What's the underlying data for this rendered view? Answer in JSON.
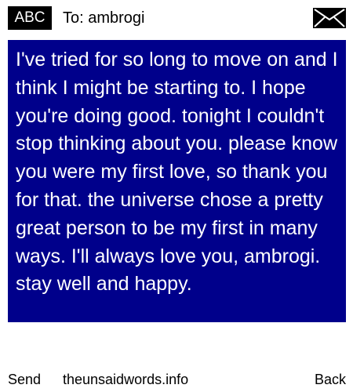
{
  "header": {
    "input_mode": "ABC",
    "recipient": "To: ambrogi",
    "icon": "envelope-icon"
  },
  "message": {
    "body": "I've tried for so long to move on and I think I might be starting to. I hope you're doing good. tonight I couldn't stop thinking about you. please know you were my first love, so thank you for that. the universe chose a pretty great person to be my first in many ways. I'll always love you, ambrogi. stay well and happy."
  },
  "softkeys": {
    "left_label": "Send",
    "center_text": "theunsaidwords.info",
    "right_label": "Back"
  },
  "colors": {
    "message_background": "#00008b",
    "message_text": "#ffffff",
    "badge_background": "#000000"
  }
}
